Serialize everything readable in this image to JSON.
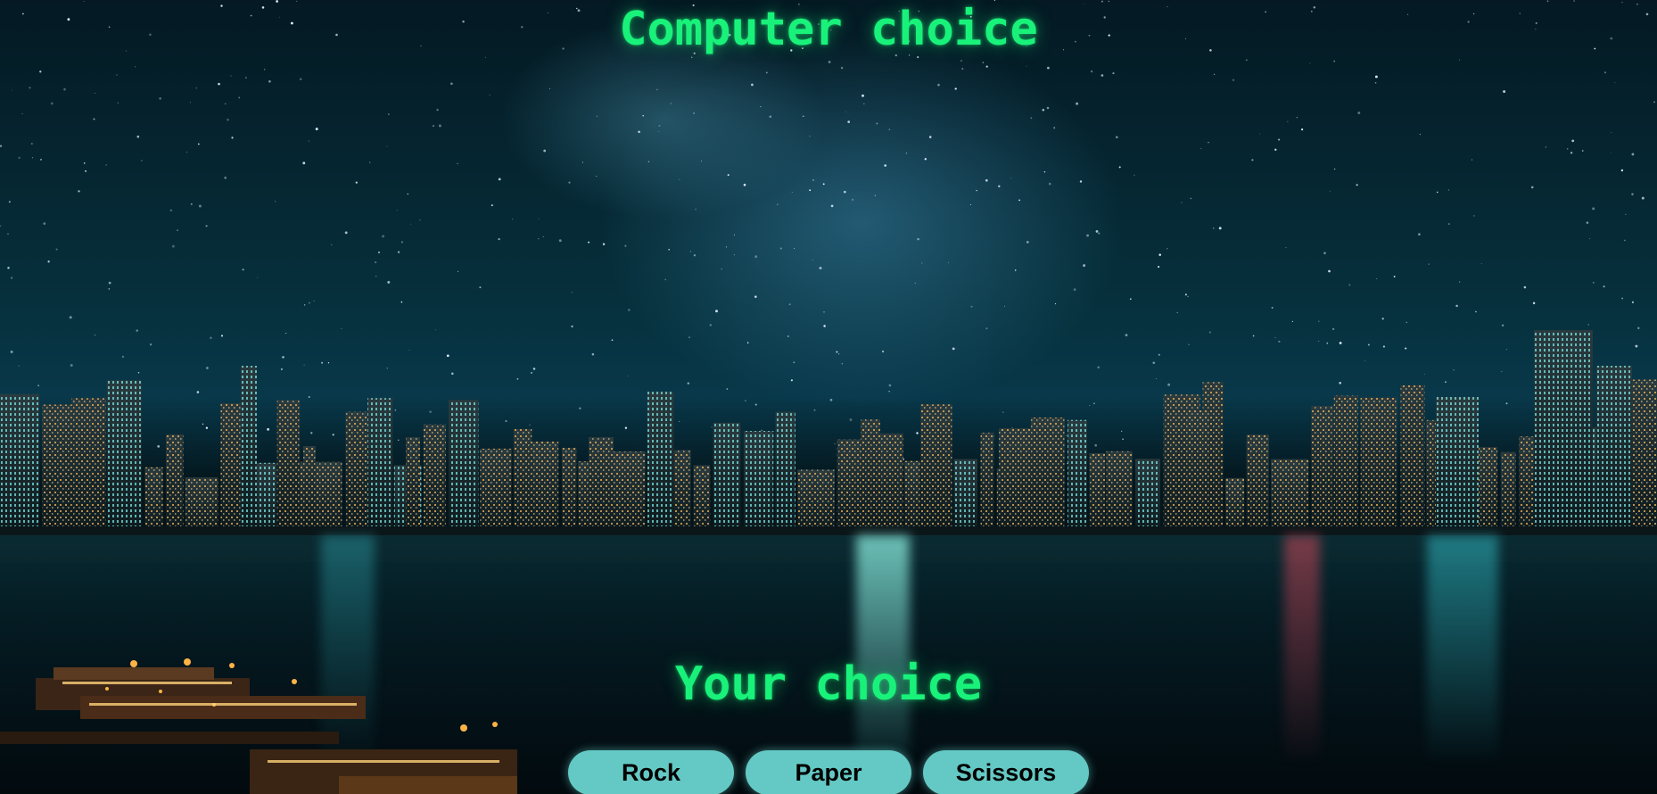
{
  "game": {
    "computer_label": "Computer choice",
    "player_label": "Your choice",
    "buttons": {
      "rock": "Rock",
      "paper": "Paper",
      "scissors": "Scissors"
    }
  },
  "colors": {
    "title": "#19f27a",
    "button": "#64c9c4",
    "button_text": "#000000"
  }
}
